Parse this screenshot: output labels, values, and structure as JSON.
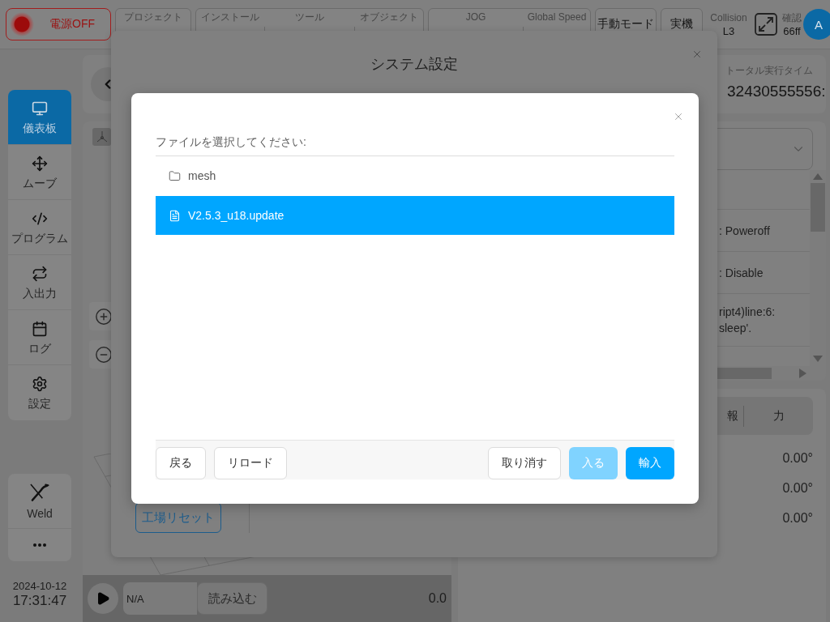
{
  "top_bar": {
    "power_button": {
      "label": "電源OFF",
      "on": false
    },
    "status_groups": [
      {
        "cells": [
          {
            "label": "プロジェクト"
          }
        ]
      },
      {
        "cells": [
          {
            "label": "インストール"
          },
          {
            "label": "ツール"
          },
          {
            "label": "オブジェクト"
          }
        ]
      },
      {
        "cells": [
          {
            "label": "JOG"
          },
          {
            "label": "Global Speed"
          }
        ]
      }
    ],
    "mode_buttons": [
      "手動モード",
      "実機"
    ],
    "collision": {
      "label": "Collision",
      "value": "L3"
    },
    "confirm": {
      "label": "確認",
      "value": "66ff"
    },
    "avatar": {
      "initial": "A"
    }
  },
  "sidebar": {
    "nav": [
      {
        "label": "儀表板",
        "selected": true
      },
      {
        "label": "ムーブ",
        "selected": false
      },
      {
        "label": "プログラム",
        "selected": false
      },
      {
        "label": "入出力",
        "selected": false
      },
      {
        "label": "ログ",
        "selected": false
      },
      {
        "label": "設定",
        "selected": false
      }
    ],
    "tools": [
      {
        "label": "Weld"
      }
    ],
    "date": "2024-10-12",
    "time": "17:31:47"
  },
  "program_bar": {
    "file_field": {
      "value": "N/A"
    },
    "load_button": "読み込む",
    "reading": "0.0"
  },
  "right_panel": {
    "runtime": {
      "label": "トータル実行タイム",
      "value": "32430555556:"
    },
    "log_rows": [
      {
        "lines": [
          ": Poweroff"
        ]
      },
      {
        "lines": [
          ": Disable"
        ]
      },
      {
        "lines": [
          "ript4)line:6:",
          "sleep'."
        ]
      }
    ],
    "tabs": [
      {
        "label": "報",
        "selected": false
      },
      {
        "label": "力",
        "selected": false
      }
    ],
    "joint_values": [
      "0.00°",
      "0.00°",
      "0.00°"
    ]
  },
  "system_settings_dialog": {
    "title": "システム設定",
    "factory_reset_button": "工場リセット"
  },
  "file_dialog": {
    "prompt": "ファイルを選択してください:",
    "files": [
      {
        "name": "mesh",
        "kind": "folder",
        "selected": false
      },
      {
        "name": "V2.5.3_u18.update",
        "kind": "file",
        "selected": true
      }
    ],
    "left_buttons": [
      {
        "label": "戻る",
        "kind": "default",
        "disabled": false
      },
      {
        "label": "リロード",
        "kind": "default",
        "disabled": false
      }
    ],
    "right_buttons": [
      {
        "label": "取り消す",
        "kind": "default",
        "disabled": false
      },
      {
        "label": "入る",
        "kind": "primary",
        "disabled": true
      },
      {
        "label": "輸入",
        "kind": "primary",
        "disabled": false
      }
    ]
  }
}
